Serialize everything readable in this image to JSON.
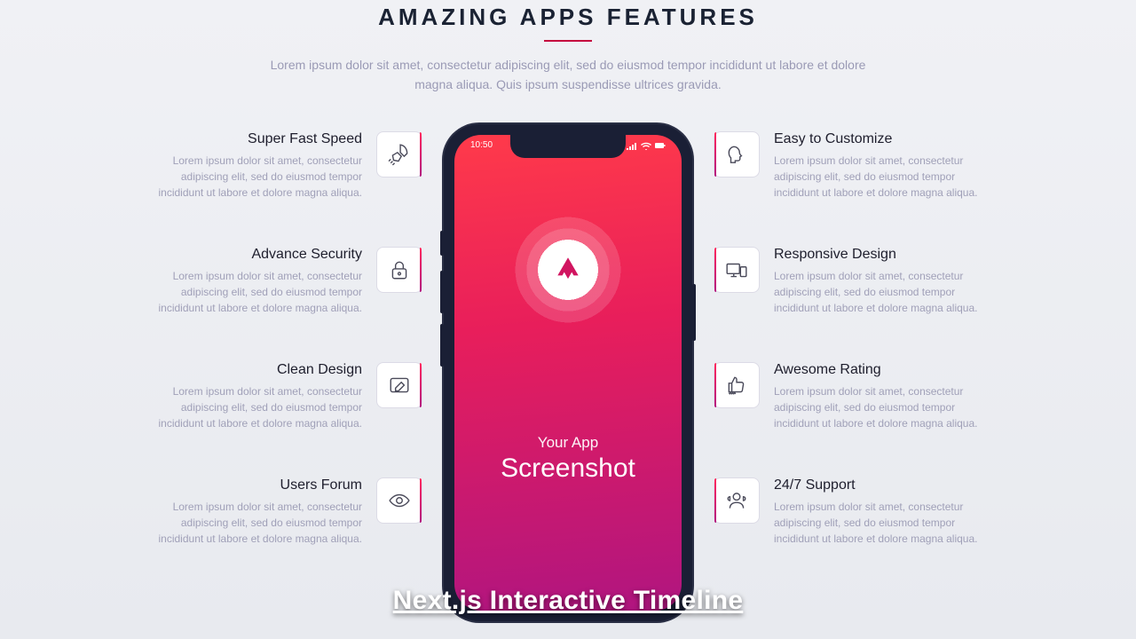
{
  "header": {
    "title": "AMAZING APPS FEATURES",
    "subtitle": "Lorem ipsum dolor sit amet, consectetur adipiscing elit, sed do eiusmod tempor incididunt ut labore et dolore magna aliqua. Quis ipsum suspendisse ultrices gravida."
  },
  "features": {
    "left": [
      {
        "title": "Super Fast Speed",
        "desc": "Lorem ipsum dolor sit amet, consectetur adipiscing elit, sed do eiusmod tempor incididunt ut labore et dolore magna aliqua.",
        "icon": "rocket-icon"
      },
      {
        "title": "Advance Security",
        "desc": "Lorem ipsum dolor sit amet, consectetur adipiscing elit, sed do eiusmod tempor incididunt ut labore et dolore magna aliqua.",
        "icon": "lock-icon"
      },
      {
        "title": "Clean Design",
        "desc": "Lorem ipsum dolor sit amet, consectetur adipiscing elit, sed do eiusmod tempor incididunt ut labore et dolore magna aliqua.",
        "icon": "pencil-icon"
      },
      {
        "title": "Users Forum",
        "desc": "Lorem ipsum dolor sit amet, consectetur adipiscing elit, sed do eiusmod tempor incididunt ut labore et dolore magna aliqua.",
        "icon": "eye-icon"
      }
    ],
    "right": [
      {
        "title": "Easy to Customize",
        "desc": "Lorem ipsum dolor sit amet, consectetur adipiscing elit, sed do eiusmod tempor incididunt ut labore et dolore magna aliqua.",
        "icon": "head-icon"
      },
      {
        "title": "Responsive Design",
        "desc": "Lorem ipsum dolor sit amet, consectetur adipiscing elit, sed do eiusmod tempor incididunt ut labore et dolore magna aliqua.",
        "icon": "devices-icon"
      },
      {
        "title": "Awesome Rating",
        "desc": "Lorem ipsum dolor sit amet, consectetur adipiscing elit, sed do eiusmod tempor incididunt ut labore et dolore magna aliqua.",
        "icon": "thumbs-icon"
      },
      {
        "title": "24/7 Support",
        "desc": "Lorem ipsum dolor sit amet, consectetur adipiscing elit, sed do eiusmod tempor incididunt ut labore et dolore magna aliqua.",
        "icon": "support-icon"
      }
    ]
  },
  "phone": {
    "time": "10:50",
    "line1": "Your App",
    "line2": "Screenshot"
  },
  "overlay": {
    "text": "Next.js Interactive Timeline"
  }
}
